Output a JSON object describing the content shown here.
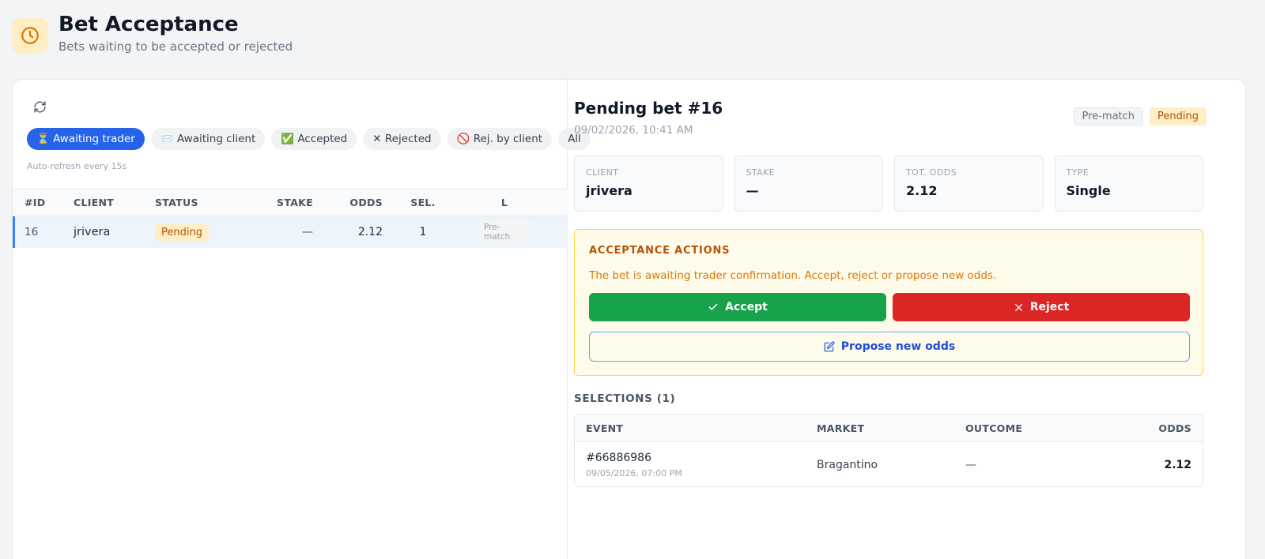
{
  "header": {
    "title": "Bet Acceptance",
    "subtitle": "Bets waiting to be accepted or rejected",
    "icon": "clock-icon"
  },
  "filters": {
    "chips": [
      {
        "label": "⏳ Awaiting trader",
        "active": true
      },
      {
        "label": "📨 Awaiting client",
        "active": false
      },
      {
        "label": "✅ Accepted",
        "active": false
      },
      {
        "label": "✕ Rejected",
        "active": false
      },
      {
        "label": "🚫 Rej. by client",
        "active": false
      },
      {
        "label": "All",
        "active": false
      }
    ],
    "auto_refresh": "Auto-refresh every 15s"
  },
  "table": {
    "columns": [
      "#ID",
      "CLIENT",
      "STATUS",
      "STAKE",
      "ODDS",
      "SEL.",
      "L"
    ],
    "rows": [
      {
        "id": "16",
        "client": "jrivera",
        "status": "Pending",
        "stake": "—",
        "odds": "2.12",
        "sel": "1",
        "type": "Pre-match"
      }
    ]
  },
  "detail": {
    "title": "Pending bet #16",
    "date": "09/02/2026, 10:41 AM",
    "badges": [
      "Pre-match",
      "Pending"
    ],
    "stats": [
      {
        "label": "CLIENT",
        "value": "jrivera"
      },
      {
        "label": "STAKE",
        "value": "—"
      },
      {
        "label": "TOT. ODDS",
        "value": "2.12"
      },
      {
        "label": "TYPE",
        "value": "Single"
      }
    ],
    "actions": {
      "title": "ACCEPTANCE ACTIONS",
      "description": "The bet is awaiting trader confirmation. Accept, reject or propose new odds.",
      "accept_label": "Accept",
      "reject_label": "Reject",
      "propose_label": "Propose new odds"
    },
    "selections": {
      "title": "SELECTIONS (1)",
      "columns": [
        "EVENT",
        "MARKET",
        "OUTCOME",
        "ODDS"
      ],
      "rows": [
        {
          "event": "#66886986",
          "event_date": "09/05/2026, 07:00 PM",
          "market": "Bragantino",
          "outcome": "—",
          "odds": "2.12"
        }
      ]
    }
  },
  "colors": {
    "primary": "#2563eb",
    "accept": "#16a34a",
    "reject": "#dc2626",
    "pending": "#b45309"
  }
}
